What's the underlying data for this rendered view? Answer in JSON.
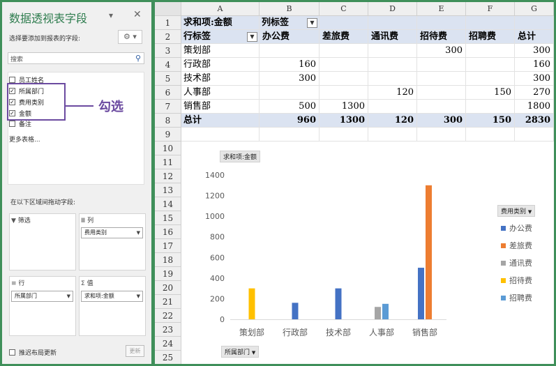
{
  "pane": {
    "title": "数据透视表字段",
    "subtitle": "选择要添加到报表的字段:",
    "search_placeholder": "搜索",
    "fields": [
      {
        "label": "员工姓名",
        "checked": false
      },
      {
        "label": "所属部门",
        "checked": true
      },
      {
        "label": "费用类别",
        "checked": true
      },
      {
        "label": "金额",
        "checked": true
      },
      {
        "label": "备注",
        "checked": false
      }
    ],
    "more_tables": "更多表格...",
    "drag_label": "在以下区域间拖动字段:",
    "areas": {
      "filter": "筛选",
      "columns": "列",
      "rows": "行",
      "values": "值"
    },
    "columns_field": "费用类别",
    "rows_field": "所属部门",
    "values_field": "求和项:金额",
    "defer_update": "推迟布局更新",
    "update_button": "更新",
    "callout": "勾选"
  },
  "sheet": {
    "columns": [
      "A",
      "B",
      "C",
      "D",
      "E",
      "F",
      "G"
    ],
    "rows": [
      "1",
      "2",
      "3",
      "4",
      "5",
      "6",
      "7",
      "8",
      "9",
      "10",
      "11",
      "12",
      "13",
      "14",
      "15",
      "16",
      "17",
      "18",
      "19",
      "20",
      "21",
      "22",
      "23",
      "24",
      "25"
    ],
    "pivot": {
      "value_label": "求和项:金额",
      "col_label": "列标签",
      "row_label": "行标签",
      "headers": [
        "办公费",
        "差旅费",
        "通讯费",
        "招待费",
        "招聘费",
        "总计"
      ],
      "data": [
        [
          "策划部",
          "",
          "",
          "",
          "300",
          "",
          "300"
        ],
        [
          "行政部",
          "160",
          "",
          "",
          "",
          "",
          "160"
        ],
        [
          "技术部",
          "300",
          "",
          "",
          "",
          "",
          "300"
        ],
        [
          "人事部",
          "",
          "",
          "120",
          "",
          "150",
          "270"
        ],
        [
          "销售部",
          "500",
          "1300",
          "",
          "",
          "",
          "1800"
        ]
      ],
      "total": [
        "总计",
        "960",
        "1300",
        "120",
        "300",
        "150",
        "2830"
      ]
    }
  },
  "chart_data": {
    "type": "bar",
    "title": "求和项:金额",
    "categories": [
      "策划部",
      "行政部",
      "技术部",
      "人事部",
      "销售部"
    ],
    "series": [
      {
        "name": "办公费",
        "color": "#4472c4",
        "values": [
          0,
          160,
          300,
          0,
          500
        ]
      },
      {
        "name": "差旅费",
        "color": "#ed7d31",
        "values": [
          0,
          0,
          0,
          0,
          1300
        ]
      },
      {
        "name": "通讯费",
        "color": "#a5a5a5",
        "values": [
          0,
          0,
          0,
          120,
          0
        ]
      },
      {
        "name": "招待费",
        "color": "#ffc000",
        "values": [
          300,
          0,
          0,
          0,
          0
        ]
      },
      {
        "name": "招聘费",
        "color": "#5b9bd5",
        "values": [
          0,
          0,
          0,
          150,
          0
        ]
      }
    ],
    "yticks": [
      "0",
      "200",
      "400",
      "600",
      "800",
      "1000",
      "1200",
      "1400"
    ],
    "ylim": [
      0,
      1400
    ],
    "legend_title": "费用类别",
    "legend_position": "right",
    "axis_field": "所属部门",
    "grid": false
  }
}
